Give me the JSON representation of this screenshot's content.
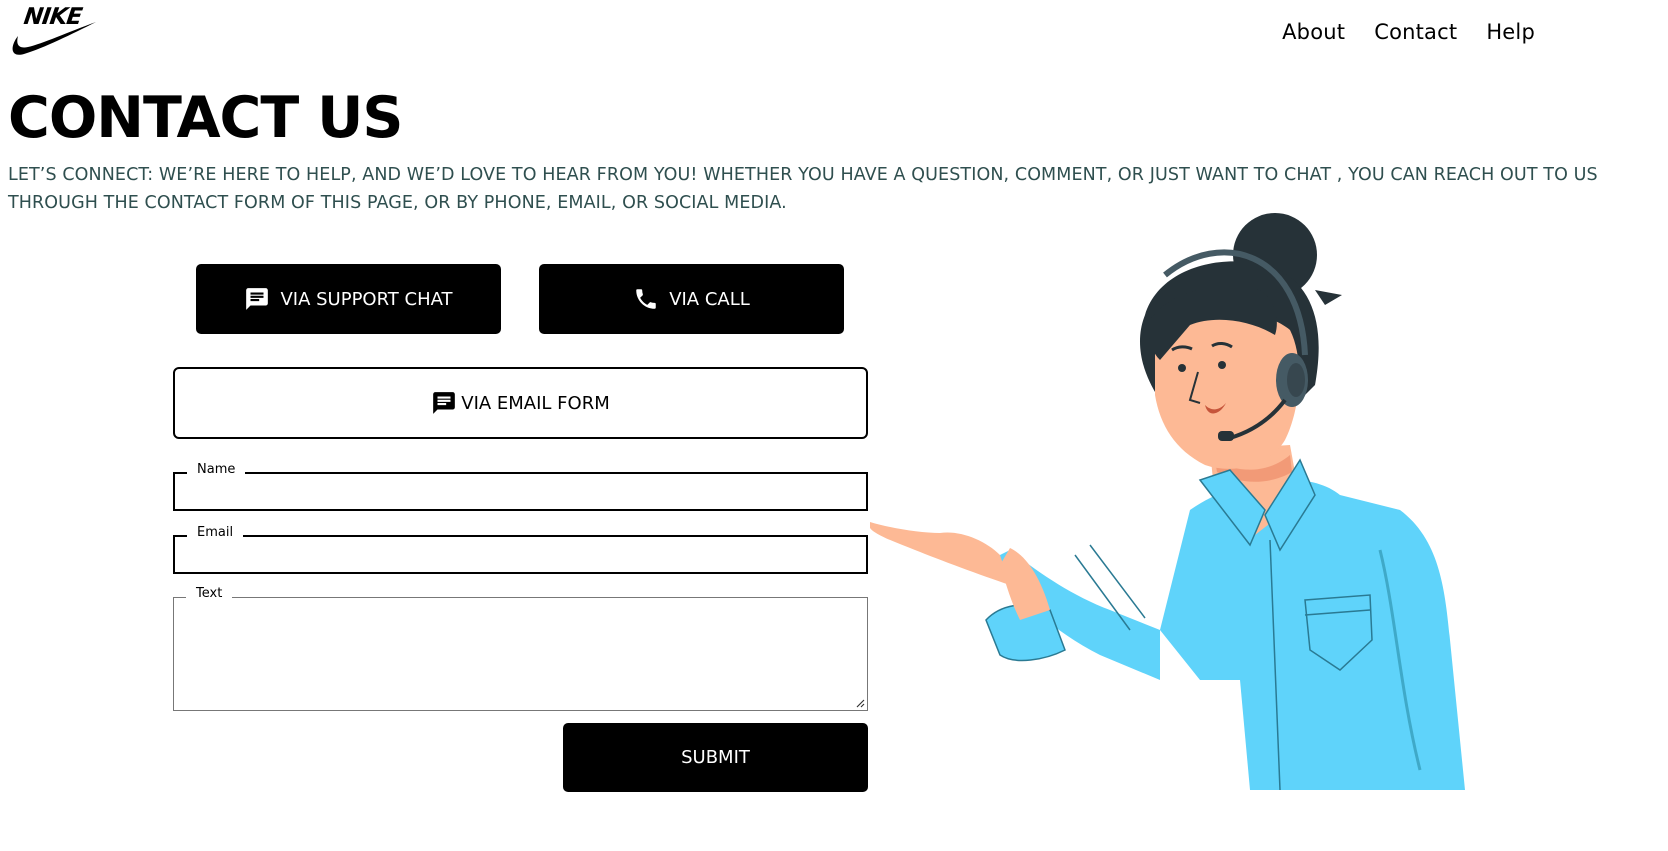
{
  "header": {
    "logo_text": "NIKE",
    "nav": [
      "About",
      "Contact",
      "Help"
    ]
  },
  "page": {
    "title": "CONTACT US",
    "intro": "LET’S CONNECT: WE’RE HERE TO HELP, AND WE’D LOVE TO HEAR FROM YOU! WHETHER YOU HAVE A QUESTION, COMMENT, OR JUST WANT TO CHAT , YOU CAN REACH OUT TO US THROUGH THE CONTACT FORM OF THIS PAGE, OR BY PHONE, EMAIL, OR SOCIAL MEDIA."
  },
  "contact_options": {
    "support_chat_label": "VIA SUPPORT CHAT",
    "call_label": "VIA CALL",
    "email_form_label": "VIA EMAIL FORM"
  },
  "form": {
    "name_label": "Name",
    "name_value": "",
    "email_label": "Email",
    "email_value": "",
    "text_label": "Text",
    "text_value": "",
    "submit_label": "SUBMIT"
  },
  "icons": {
    "chat": "chat-bubble-icon",
    "call": "phone-icon",
    "email_form": "chat-bubble-icon",
    "logo": "swoosh-icon"
  },
  "colors": {
    "button_bg": "#000000",
    "button_text": "#ffffff",
    "intro_text": "#2f4f4f",
    "shirt": "#5fd3fa",
    "skin": "#fdb995",
    "hair": "#263238"
  }
}
